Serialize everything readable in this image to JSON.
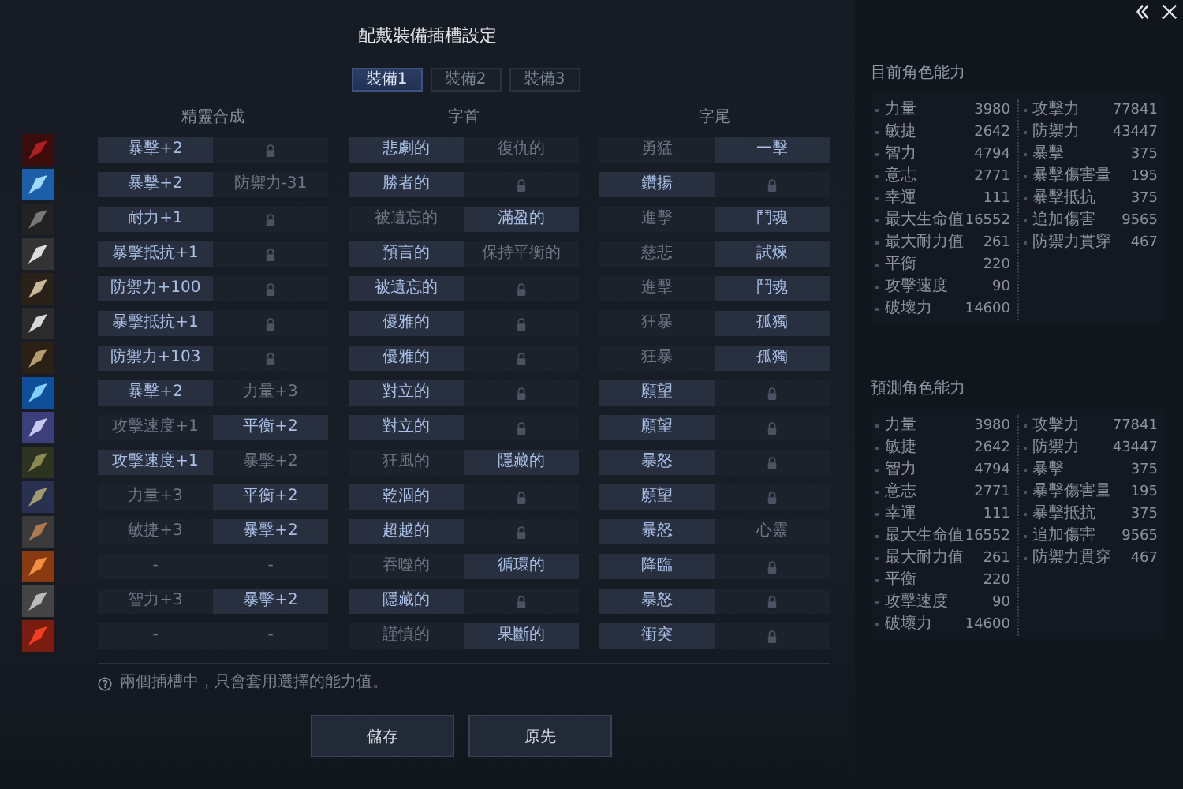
{
  "dialog": {
    "title": "配戴裝備插槽設定"
  },
  "tabs": [
    {
      "label": "裝備1",
      "selected": true
    },
    {
      "label": "裝備2",
      "selected": false
    },
    {
      "label": "裝備3",
      "selected": false
    }
  ],
  "columns": [
    "精靈合成",
    "字首",
    "字尾"
  ],
  "rows": [
    {
      "cells": [
        {
          "kind": "text",
          "text": "暴擊+2",
          "selected": true
        },
        {
          "kind": "lock",
          "selected": false
        },
        {
          "kind": "text",
          "text": "悲劇的",
          "selected": true
        },
        {
          "kind": "text",
          "text": "復仇的",
          "selected": false
        },
        {
          "kind": "text",
          "text": "勇猛",
          "selected": false
        },
        {
          "kind": "text",
          "text": "一擊",
          "selected": true
        }
      ]
    },
    {
      "cells": [
        {
          "kind": "text",
          "text": "暴擊+2",
          "selected": true
        },
        {
          "kind": "text",
          "text": "防禦力-31",
          "selected": false
        },
        {
          "kind": "text",
          "text": "勝者的",
          "selected": true
        },
        {
          "kind": "lock",
          "selected": false
        },
        {
          "kind": "text",
          "text": "鑽揚",
          "selected": true
        },
        {
          "kind": "lock",
          "selected": false
        }
      ]
    },
    {
      "cells": [
        {
          "kind": "text",
          "text": "耐力+1",
          "selected": true
        },
        {
          "kind": "lock",
          "selected": false
        },
        {
          "kind": "text",
          "text": "被遺忘的",
          "selected": false
        },
        {
          "kind": "text",
          "text": "滿盈的",
          "selected": true
        },
        {
          "kind": "text",
          "text": "進擊",
          "selected": false
        },
        {
          "kind": "text",
          "text": "鬥魂",
          "selected": true
        }
      ]
    },
    {
      "cells": [
        {
          "kind": "text",
          "text": "暴擊抵抗+1",
          "selected": true
        },
        {
          "kind": "lock",
          "selected": false
        },
        {
          "kind": "text",
          "text": "預言的",
          "selected": true
        },
        {
          "kind": "text",
          "text": "保持平衡的",
          "selected": false
        },
        {
          "kind": "text",
          "text": "慈悲",
          "selected": false
        },
        {
          "kind": "text",
          "text": "試煉",
          "selected": true
        }
      ]
    },
    {
      "cells": [
        {
          "kind": "text",
          "text": "防禦力+100",
          "selected": true
        },
        {
          "kind": "lock",
          "selected": false
        },
        {
          "kind": "text",
          "text": "被遺忘的",
          "selected": true
        },
        {
          "kind": "lock",
          "selected": false
        },
        {
          "kind": "text",
          "text": "進擊",
          "selected": false
        },
        {
          "kind": "text",
          "text": "鬥魂",
          "selected": true
        }
      ]
    },
    {
      "cells": [
        {
          "kind": "text",
          "text": "暴擊抵抗+1",
          "selected": true
        },
        {
          "kind": "lock",
          "selected": false
        },
        {
          "kind": "text",
          "text": "優雅的",
          "selected": true
        },
        {
          "kind": "lock",
          "selected": false
        },
        {
          "kind": "text",
          "text": "狂暴",
          "selected": false
        },
        {
          "kind": "text",
          "text": "孤獨",
          "selected": true
        }
      ]
    },
    {
      "cells": [
        {
          "kind": "text",
          "text": "防禦力+103",
          "selected": true
        },
        {
          "kind": "lock",
          "selected": false
        },
        {
          "kind": "text",
          "text": "優雅的",
          "selected": true
        },
        {
          "kind": "lock",
          "selected": false
        },
        {
          "kind": "text",
          "text": "狂暴",
          "selected": false
        },
        {
          "kind": "text",
          "text": "孤獨",
          "selected": true
        }
      ]
    },
    {
      "cells": [
        {
          "kind": "text",
          "text": "暴擊+2",
          "selected": true
        },
        {
          "kind": "text",
          "text": "力量+3",
          "selected": false
        },
        {
          "kind": "text",
          "text": "對立的",
          "selected": true
        },
        {
          "kind": "lock",
          "selected": false
        },
        {
          "kind": "text",
          "text": "願望",
          "selected": true
        },
        {
          "kind": "lock",
          "selected": false
        }
      ]
    },
    {
      "cells": [
        {
          "kind": "text",
          "text": "攻擊速度+1",
          "selected": false
        },
        {
          "kind": "text",
          "text": "平衡+2",
          "selected": true
        },
        {
          "kind": "text",
          "text": "對立的",
          "selected": true
        },
        {
          "kind": "lock",
          "selected": false
        },
        {
          "kind": "text",
          "text": "願望",
          "selected": true
        },
        {
          "kind": "lock",
          "selected": false
        }
      ]
    },
    {
      "cells": [
        {
          "kind": "text",
          "text": "攻擊速度+1",
          "selected": true
        },
        {
          "kind": "text",
          "text": "暴擊+2",
          "selected": false
        },
        {
          "kind": "text",
          "text": "狂風的",
          "selected": false
        },
        {
          "kind": "text",
          "text": "隱藏的",
          "selected": true
        },
        {
          "kind": "text",
          "text": "暴怒",
          "selected": true
        },
        {
          "kind": "lock",
          "selected": false
        }
      ]
    },
    {
      "cells": [
        {
          "kind": "text",
          "text": "力量+3",
          "selected": false
        },
        {
          "kind": "text",
          "text": "平衡+2",
          "selected": true
        },
        {
          "kind": "text",
          "text": "乾涸的",
          "selected": true
        },
        {
          "kind": "lock",
          "selected": false
        },
        {
          "kind": "text",
          "text": "願望",
          "selected": true
        },
        {
          "kind": "lock",
          "selected": false
        }
      ]
    },
    {
      "cells": [
        {
          "kind": "text",
          "text": "敏捷+3",
          "selected": false
        },
        {
          "kind": "text",
          "text": "暴擊+2",
          "selected": true
        },
        {
          "kind": "text",
          "text": "超越的",
          "selected": true
        },
        {
          "kind": "lock",
          "selected": false
        },
        {
          "kind": "text",
          "text": "暴怒",
          "selected": true
        },
        {
          "kind": "text",
          "text": "心靈",
          "selected": false
        }
      ]
    },
    {
      "cells": [
        {
          "kind": "text",
          "text": "-",
          "selected": false
        },
        {
          "kind": "text",
          "text": "-",
          "selected": false
        },
        {
          "kind": "text",
          "text": "吞噬的",
          "selected": false
        },
        {
          "kind": "text",
          "text": "循環的",
          "selected": true
        },
        {
          "kind": "text",
          "text": "降臨",
          "selected": true
        },
        {
          "kind": "lock",
          "selected": false
        }
      ]
    },
    {
      "cells": [
        {
          "kind": "text",
          "text": "智力+3",
          "selected": false
        },
        {
          "kind": "text",
          "text": "暴擊+2",
          "selected": true
        },
        {
          "kind": "text",
          "text": "隱藏的",
          "selected": true
        },
        {
          "kind": "lock",
          "selected": false
        },
        {
          "kind": "text",
          "text": "暴怒",
          "selected": true
        },
        {
          "kind": "lock",
          "selected": false
        }
      ]
    },
    {
      "cells": [
        {
          "kind": "text",
          "text": "-",
          "selected": false
        },
        {
          "kind": "text",
          "text": "-",
          "selected": false
        },
        {
          "kind": "text",
          "text": "謹慎的",
          "selected": false
        },
        {
          "kind": "text",
          "text": "果斷的",
          "selected": true
        },
        {
          "kind": "text",
          "text": "衝突",
          "selected": true
        },
        {
          "kind": "lock",
          "selected": false
        }
      ]
    }
  ],
  "note": "兩個插槽中，只會套用選擇的能力值。",
  "buttons": [
    "儲存",
    "原先"
  ],
  "stat_panels": [
    {
      "title": "目前角色能力",
      "left": [
        {
          "label": "力量",
          "value": "3980"
        },
        {
          "label": "敏捷",
          "value": "2642"
        },
        {
          "label": "智力",
          "value": "4794"
        },
        {
          "label": "意志",
          "value": "2771"
        },
        {
          "label": "幸運",
          "value": "111"
        },
        {
          "label": "最大生命值",
          "value": "16552"
        },
        {
          "label": "最大耐力值",
          "value": "261"
        },
        {
          "label": "平衡",
          "value": "220"
        },
        {
          "label": "攻擊速度",
          "value": "90"
        },
        {
          "label": "破壞力",
          "value": "14600"
        }
      ],
      "right": [
        {
          "label": "攻擊力",
          "value": "77841"
        },
        {
          "label": "防禦力",
          "value": "43447"
        },
        {
          "label": "暴擊",
          "value": "375"
        },
        {
          "label": "暴擊傷害量",
          "value": "195"
        },
        {
          "label": "暴擊抵抗",
          "value": "375"
        },
        {
          "label": "追加傷害",
          "value": "9565"
        },
        {
          "label": "防禦力貫穿",
          "value": "467"
        }
      ]
    },
    {
      "title": "預測角色能力",
      "left": [
        {
          "label": "力量",
          "value": "3980"
        },
        {
          "label": "敏捷",
          "value": "2642"
        },
        {
          "label": "智力",
          "value": "4794"
        },
        {
          "label": "意志",
          "value": "2771"
        },
        {
          "label": "幸運",
          "value": "111"
        },
        {
          "label": "最大生命值",
          "value": "16552"
        },
        {
          "label": "最大耐力值",
          "value": "261"
        },
        {
          "label": "平衡",
          "value": "220"
        },
        {
          "label": "攻擊速度",
          "value": "90"
        },
        {
          "label": "破壞力",
          "value": "14600"
        }
      ],
      "right": [
        {
          "label": "攻擊力",
          "value": "77841"
        },
        {
          "label": "防禦力",
          "value": "43447"
        },
        {
          "label": "暴擊",
          "value": "375"
        },
        {
          "label": "暴擊傷害量",
          "value": "195"
        },
        {
          "label": "暴擊抵抗",
          "value": "375"
        },
        {
          "label": "追加傷害",
          "value": "9565"
        },
        {
          "label": "防禦力貫穿",
          "value": "467"
        }
      ]
    }
  ]
}
